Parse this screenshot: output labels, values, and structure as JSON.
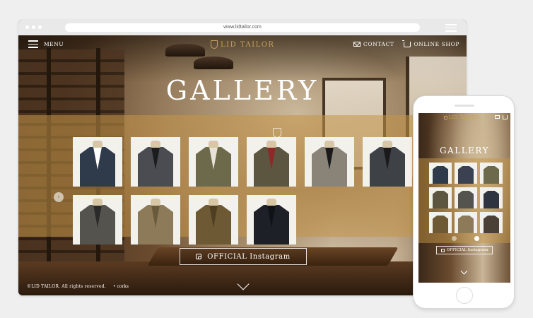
{
  "browser": {
    "url": "www.lidtailor.com"
  },
  "nav": {
    "menu_label": "MENU",
    "logo_text": "LID TAILOR",
    "contact_label": "CONTACT",
    "shop_label": "ONLINE SHOP"
  },
  "hero": {
    "title": "GALLERY",
    "instagram_label": "OFFICIAL Instagram",
    "copyright": "©LID TAILOR. All rights reserved.",
    "credit": "• corks"
  },
  "gallery": {
    "items": [
      {
        "jacket": "#2f3a4a",
        "shirt": "#ffffff"
      },
      {
        "jacket": "#4a4c52",
        "shirt": "#1c1c1c"
      },
      {
        "jacket": "#6c6a4a",
        "shirt": "#e8e2d6"
      },
      {
        "jacket": "#5c5640",
        "shirt": "#8c2a2a"
      },
      {
        "jacket": "#8a8478",
        "shirt": "#1a1a1a"
      },
      {
        "jacket": "#3e4247",
        "shirt": "#1a1a1a"
      },
      {
        "jacket": "#55534d",
        "shirt": "#2a2a2a"
      },
      {
        "jacket": "#8c7a58",
        "shirt": "#6a5a3c"
      },
      {
        "jacket": "#6d5a34",
        "shirt": "#4e3f22"
      },
      {
        "jacket": "#1d2127",
        "shirt": "#0f1216"
      }
    ]
  },
  "phone": {
    "logo_text": "LID TAILOR",
    "title": "GALLERY",
    "instagram_label": "OFFICIAL Instagram",
    "items": [
      "#2f3a4a",
      "#3b4150",
      "#6c6a4a",
      "#5c5640",
      "#55534d",
      "#2e3440",
      "#6d5a34",
      "#8c7a58",
      "#4a4036"
    ]
  }
}
